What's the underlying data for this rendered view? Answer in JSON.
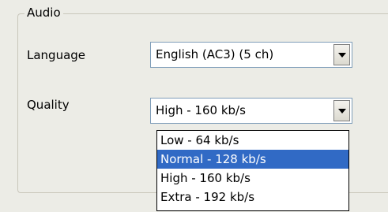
{
  "group": {
    "title": "Audio"
  },
  "language": {
    "label": "Language",
    "selected": "English (AC3) (5 ch)"
  },
  "quality": {
    "label": "Quality",
    "selected": "High - 160 kb/s",
    "options": [
      "Low - 64 kb/s",
      "Normal - 128 kb/s",
      "High - 160 kb/s",
      "Extra - 192 kb/s"
    ],
    "highlighted_option": "Normal - 128 kb/s"
  },
  "colors": {
    "highlight": "#316ac5",
    "window_bg": "#ecece6",
    "combo_border": "#7f9db9"
  }
}
